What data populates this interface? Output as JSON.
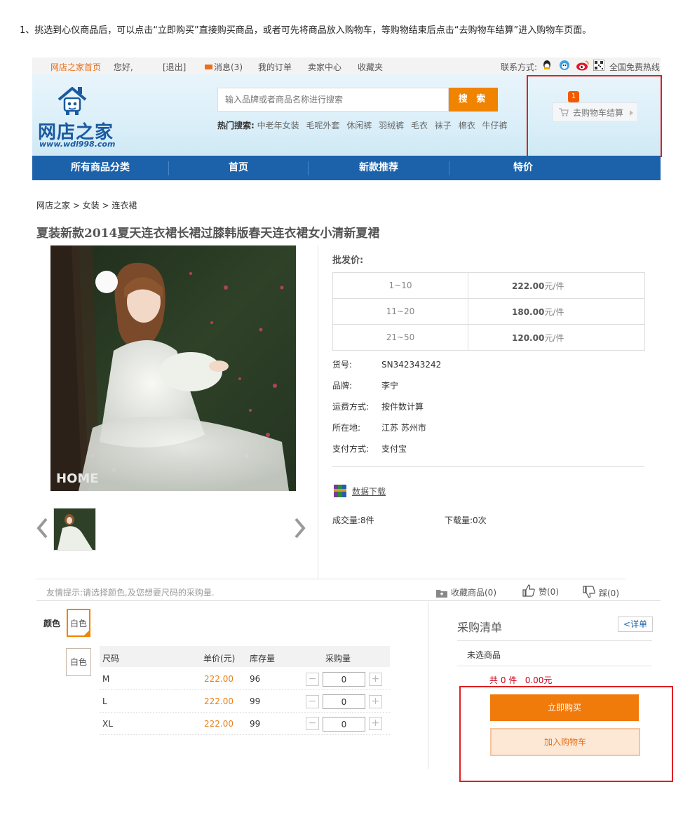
{
  "intro": "1、挑选到心仪商品后，可以点击“立即购买”直接购买商品，或者可先将商品放入购物车，等购物结束后点击“去购物车结算”进入购物车页面。",
  "topbar": {
    "home": "网店之家首页",
    "greeting": "您好,",
    "logout": "[退出]",
    "messages": "消息(3)",
    "orders": "我的订单",
    "seller": "卖家中心",
    "favorites": "收藏夹",
    "contact": "联系方式:",
    "hotline": "全国免费热线"
  },
  "header": {
    "logo_text": "网店之家",
    "logo_url": "www.wdl998.com",
    "search_placeholder": "输入品牌或者商品名称进行搜索",
    "search_button": "搜 索",
    "hot_label": "热门搜索:",
    "hot_terms": [
      "中老年女装",
      "毛呢外套",
      "休闲裤",
      "羽绒裤",
      "毛衣",
      "袜子",
      "棉衣",
      "牛仔裤"
    ],
    "cart_label": "去购物车结算",
    "cart_count": "1"
  },
  "nav": [
    "所有商品分类",
    "首页",
    "新款推荐",
    "特价"
  ],
  "breadcrumb": "网店之家 > 女装 > 连衣裙",
  "product": {
    "title": "夏装新款2014夏天连衣裙长裙过膝韩版春天连衣裙女小清新夏裙",
    "watermark": "HOME",
    "price_label": "批发价:",
    "tiers": [
      {
        "range": "1~10",
        "price": "222.00",
        "unit": "元/件"
      },
      {
        "range": "11~20",
        "price": "180.00",
        "unit": "元/件"
      },
      {
        "range": "21~50",
        "price": "120.00",
        "unit": "元/件"
      }
    ],
    "attrs": [
      {
        "k": "货号:",
        "v": "SN342343242"
      },
      {
        "k": "品牌:",
        "v": "李宁"
      },
      {
        "k": "运费方式:",
        "v": "按件数计算"
      },
      {
        "k": "所在地:",
        "v": "江苏 苏州市"
      },
      {
        "k": "支付方式:",
        "v": "支付宝"
      }
    ],
    "download": "数据下载",
    "sold": "成交量:8件",
    "downloads": "下载量:0次"
  },
  "tipbar": {
    "tip": "友情提示:请选择颜色,及您想要尺码的采购量.",
    "collect": "收藏商品(0)",
    "like": "赞(0)",
    "dislike": "踩(0)"
  },
  "options": {
    "color_label": "颜色",
    "colors": [
      "白色",
      "白色"
    ],
    "headers": [
      "尺码",
      "单价(元)",
      "库存量",
      "采购量"
    ],
    "rows": [
      {
        "size": "M",
        "price": "222.00",
        "stock": "96",
        "qty": "0"
      },
      {
        "size": "L",
        "price": "222.00",
        "stock": "99",
        "qty": "0"
      },
      {
        "size": "XL",
        "price": "222.00",
        "stock": "99",
        "qty": "0"
      }
    ]
  },
  "purchase": {
    "title": "采购清单",
    "detail": "<详单",
    "none": "未选商品",
    "total": "共 0 件   0.00元",
    "buy_now": "立即购买",
    "add_cart": "加入购物车"
  },
  "colors": {
    "accent": "#f08300",
    "nav": "#1c62ab",
    "highlight": "#e02020"
  }
}
